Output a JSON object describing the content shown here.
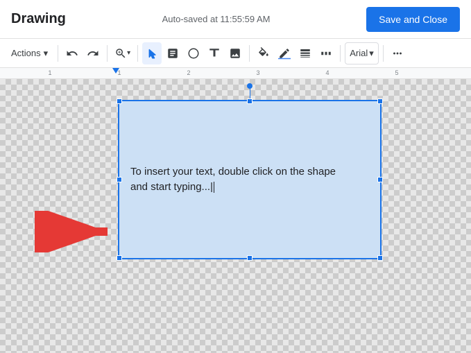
{
  "header": {
    "title": "Drawing",
    "autosave": "Auto-saved at 11:55:59 AM",
    "save_close_label": "Save and Close"
  },
  "toolbar": {
    "actions_label": "Actions",
    "actions_arrow": "▾",
    "font_name": "Arial",
    "font_arrow": "▾"
  },
  "shape": {
    "text_line1": "To insert your text, double click on the shape",
    "text_line2": "and start typing...|"
  }
}
